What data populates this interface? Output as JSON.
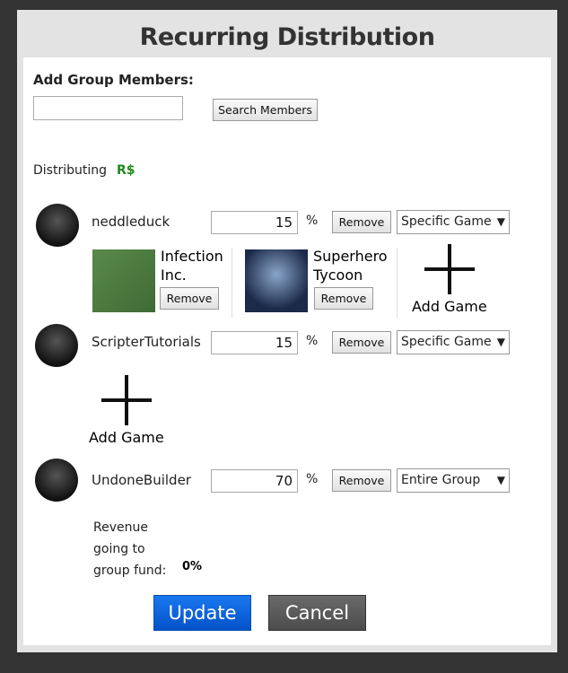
{
  "title": "Recurring Distribution",
  "add_members_label": "Add Group Members:",
  "search_value": "",
  "search_button": "Search Members",
  "distributing_label": "Distributing",
  "currency_icon": "R$",
  "members": [
    {
      "name": "neddleduck",
      "percent": "15",
      "remove": "Remove",
      "mode": "Specific Game",
      "games": [
        {
          "name": "Infection Inc.",
          "remove": "Remove"
        },
        {
          "name": "Superhero Tycoon",
          "remove": "Remove"
        }
      ],
      "add_game": "Add Game"
    },
    {
      "name": "ScripterTutorials",
      "percent": "15",
      "remove": "Remove",
      "mode": "Specific Game",
      "add_game": "Add Game"
    },
    {
      "name": "UndoneBuilder",
      "percent": "70",
      "remove": "Remove",
      "mode": "Entire Group"
    }
  ],
  "percent_sign": "%",
  "group_fund_label": "Revenue going to group fund:",
  "group_fund_value": "0%",
  "update_button": "Update",
  "cancel_button": "Cancel",
  "colors": {
    "accent": "#0b63d8",
    "currency": "#1e8a1e"
  }
}
